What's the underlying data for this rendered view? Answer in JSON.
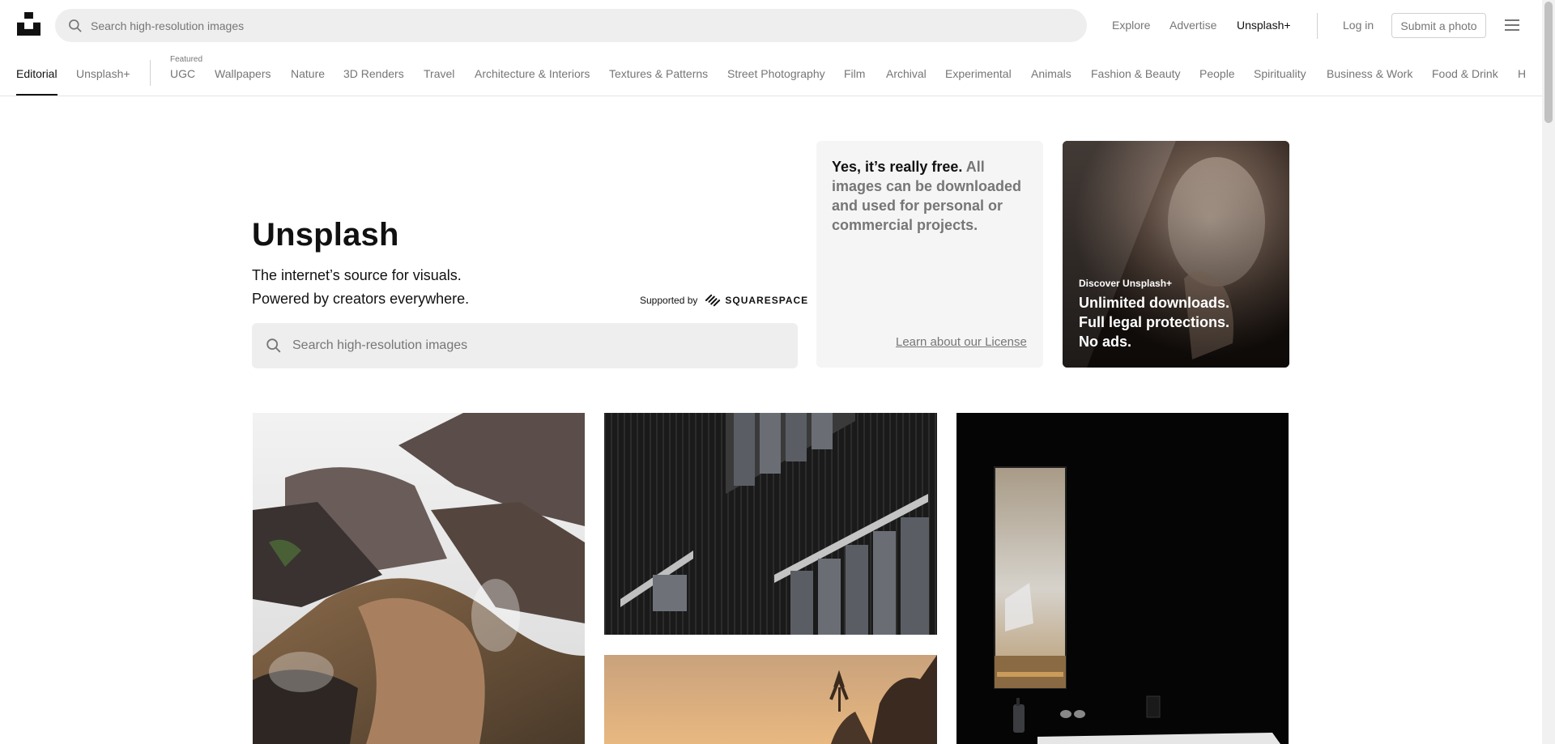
{
  "header": {
    "search_placeholder": "Search high-resolution images",
    "links": {
      "explore": "Explore",
      "advertise": "Advertise",
      "unsplash_plus": "Unsplash+",
      "login": "Log in"
    },
    "submit_label": "Submit a photo"
  },
  "topics": {
    "editorial": "Editorial",
    "unsplash_plus": "Unsplash+",
    "featured_label": "Featured",
    "items": [
      "UGC",
      "Wallpapers",
      "Nature",
      "3D Renders",
      "Travel",
      "Architecture & Interiors",
      "Textures & Patterns",
      "Street Photography",
      "Film",
      "Archival",
      "Experimental",
      "Animals",
      "Fashion & Beauty",
      "People",
      "Spirituality",
      "Business & Work",
      "Food & Drink",
      "H"
    ]
  },
  "hero": {
    "title": "Unsplash",
    "subtitle_line1": "The internet’s source for visuals.",
    "subtitle_line2": "Powered by creators everywhere.",
    "supported_by": "Supported by",
    "sponsor": "SQUARESPACE",
    "search_placeholder": "Search high-resolution images"
  },
  "free_card": {
    "bold": "Yes, it’s really free.",
    "rest": " All images can be downloaded and used for personal or commercial projects.",
    "license_link": "Learn about our License"
  },
  "plus_card": {
    "kicker": "Discover Unsplash+",
    "line1": "Unlimited downloads.",
    "line2": "Full legal protections.",
    "line3": "No ads."
  },
  "colors": {
    "text": "#111111",
    "muted": "#767676",
    "search_bg": "#eeeeee",
    "border": "#d1d1d1"
  }
}
